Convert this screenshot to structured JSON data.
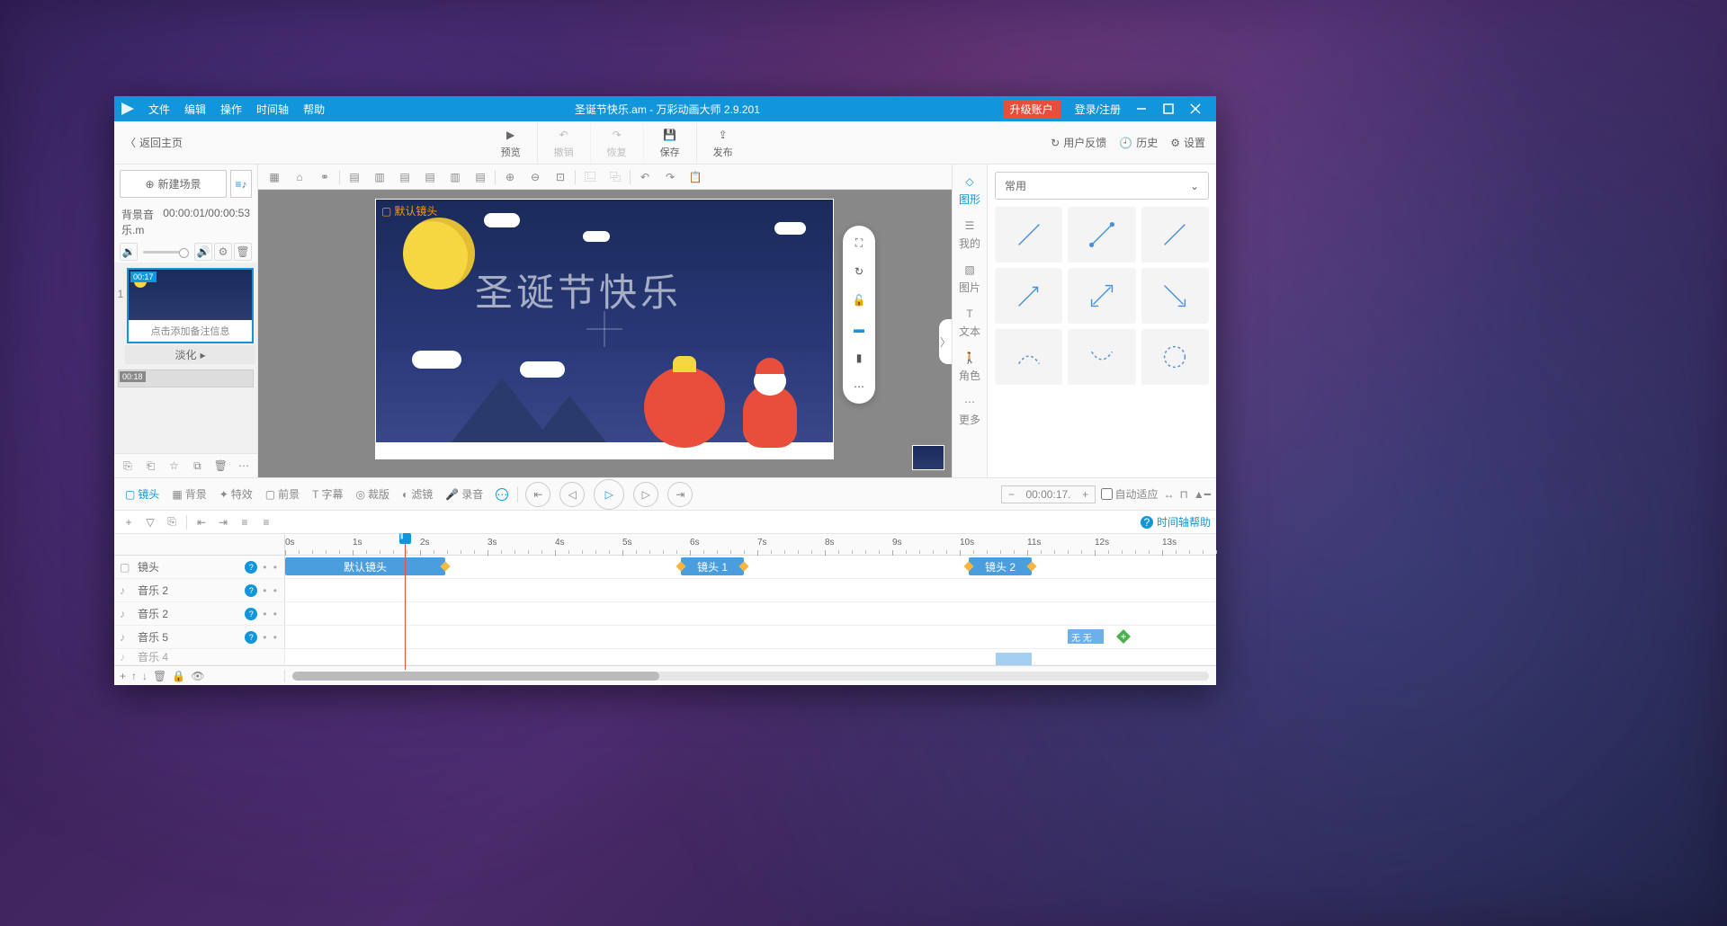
{
  "titlebar": {
    "menu": [
      "文件",
      "编辑",
      "操作",
      "时间轴",
      "帮助"
    ],
    "title": "圣诞节快乐.am - 万彩动画大师 2.9.201",
    "upgrade": "升级账户",
    "login": "登录/注册"
  },
  "toolbar2": {
    "back": "返回主页",
    "buttons": [
      {
        "label": "预览",
        "icon": "play"
      },
      {
        "label": "撤销",
        "icon": "undo"
      },
      {
        "label": "恢复",
        "icon": "redo"
      },
      {
        "label": "保存",
        "icon": "save"
      },
      {
        "label": "发布",
        "icon": "publish"
      }
    ],
    "right": [
      {
        "label": "用户反馈",
        "icon": "refresh"
      },
      {
        "label": "历史",
        "icon": "history"
      },
      {
        "label": "设置",
        "icon": "gear"
      }
    ]
  },
  "left": {
    "new_scene": "新建场景",
    "audio_name": "背景音乐.m",
    "audio_time": "00:00:01/00:00:53",
    "scene1": {
      "time": "00:17",
      "caption": "点击添加备注信息",
      "transition": "淡化"
    },
    "scene2": {
      "time": "00:18"
    }
  },
  "canvas": {
    "cam_label": "默认镜头",
    "title_text": "圣诞节快乐"
  },
  "right_tabs": [
    "图形",
    "我的",
    "图片",
    "文本",
    "角色",
    "更多"
  ],
  "shape_category": "常用",
  "timeline_tabs": [
    "镜头",
    "背景",
    "特效",
    "前景",
    "字幕",
    "裁版",
    "滤镜",
    "录音"
  ],
  "timeline": {
    "time_display": "00:00:17.",
    "auto_fit": "自动适应",
    "help": "时间轴帮助",
    "ticks": [
      "0s",
      "1s",
      "2s",
      "3s",
      "4s",
      "5s",
      "6s",
      "7s",
      "8s",
      "9s",
      "10s",
      "11s",
      "12s",
      "13s"
    ],
    "tracks": [
      {
        "icon": "camera",
        "name": "镜头"
      },
      {
        "icon": "music",
        "name": "音乐 2"
      },
      {
        "icon": "music",
        "name": "音乐 2"
      },
      {
        "icon": "music",
        "name": "音乐 5"
      },
      {
        "icon": "music",
        "name": "音乐 4"
      }
    ],
    "clips": {
      "default_cam": "默认镜头",
      "cam1": "镜头 1",
      "cam2": "镜头 2",
      "nowu": "无 无"
    }
  }
}
